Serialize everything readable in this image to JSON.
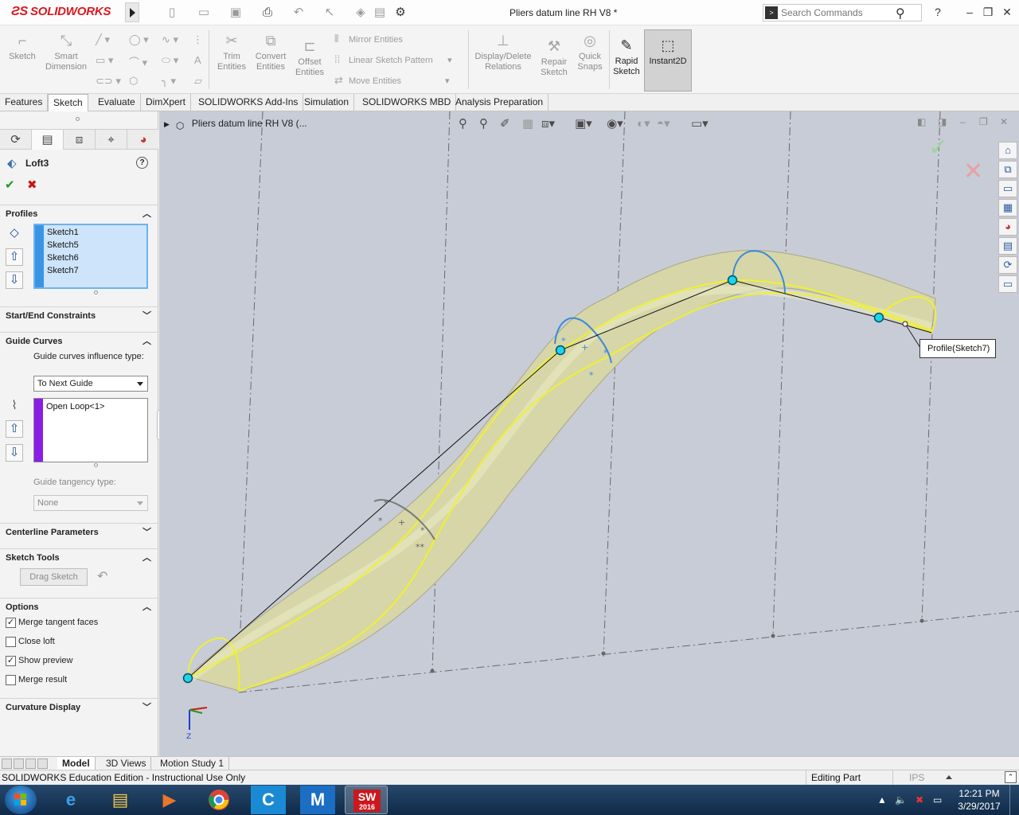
{
  "app": {
    "brand": "SOLIDWORKS",
    "document_title": "Pliers datum line RH V8 *",
    "search_placeholder": "Search Commands",
    "help_label": "?"
  },
  "ribbon": {
    "sketch": "Sketch",
    "smart_dimension": [
      "Smart",
      "Dimension"
    ],
    "trim_entities": [
      "Trim",
      "Entities"
    ],
    "convert_entities": [
      "Convert",
      "Entities"
    ],
    "offset_entities": [
      "Offset",
      "Entities"
    ],
    "mirror_entities": "Mirror Entities",
    "linear_sketch_pattern": "Linear Sketch Pattern",
    "move_entities": "Move Entities",
    "display_delete_relations": [
      "Display/Delete",
      "Relations"
    ],
    "repair_sketch": [
      "Repair",
      "Sketch"
    ],
    "quick_snaps": [
      "Quick",
      "Snaps"
    ],
    "rapid_sketch": [
      "Rapid",
      "Sketch"
    ],
    "instant2d": "Instant2D"
  },
  "tabs": [
    "Features",
    "Sketch",
    "Evaluate",
    "DimXpert",
    "SOLIDWORKS Add-Ins",
    "Simulation",
    "SOLIDWORKS MBD",
    "Analysis Preparation"
  ],
  "active_tab": "Sketch",
  "property_manager": {
    "feature_name": "Loft3",
    "profiles": {
      "header": "Profiles",
      "items": [
        "Sketch1",
        "Sketch5",
        "Sketch6",
        "Sketch7"
      ]
    },
    "start_end_constraints": "Start/End Constraints",
    "guide_curves": {
      "header": "Guide Curves",
      "influence_label": "Guide curves influence type:",
      "influence_value": "To Next Guide",
      "items": [
        "Open Loop<1>"
      ],
      "tangency_label": "Guide tangency type:",
      "tangency_value": "None"
    },
    "centerline_parameters": "Centerline Parameters",
    "sketch_tools": {
      "header": "Sketch Tools",
      "drag_sketch": "Drag Sketch"
    },
    "options": {
      "header": "Options",
      "merge_tangent_faces": {
        "label": "Merge tangent faces",
        "checked": true
      },
      "close_loft": {
        "label": "Close loft",
        "checked": false
      },
      "show_preview": {
        "label": "Show preview",
        "checked": true
      },
      "merge_result": {
        "label": "Merge result",
        "checked": false
      }
    },
    "curvature_display": "Curvature Display"
  },
  "viewport": {
    "tree_label": "Pliers datum line RH V8  (...",
    "tooltip": "Profile(Sketch7)",
    "triad_z": "Z",
    "colors": {
      "background": "#c8ccd6",
      "loft_body": "#d6d6a9",
      "guide_curve": "#f0f030",
      "profile_blue": "#3a8ad8",
      "point": "#19d6e8"
    }
  },
  "bottom_tabs": [
    "Model",
    "3D Views",
    "Motion Study 1"
  ],
  "status": {
    "left": "SOLIDWORKS Education Edition - Instructional Use Only",
    "mode": "Editing Part",
    "units": "IPS"
  },
  "taskbar": {
    "time": "12:21 PM",
    "date": "3/29/2017",
    "sw_badge": "2016"
  }
}
